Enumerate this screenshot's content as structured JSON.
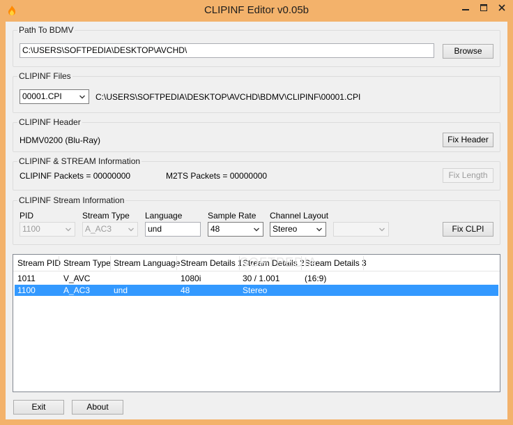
{
  "window": {
    "title": "CLIPINF Editor v0.05b",
    "icon": "flame-app-icon",
    "controls": {
      "minimize": "–",
      "maximize": "☐",
      "close": "✕"
    }
  },
  "path_group": {
    "title": "Path To BDMV",
    "path_value": "C:\\USERS\\SOFTPEDIA\\DESKTOP\\AVCHD\\",
    "browse_label": "Browse"
  },
  "files_group": {
    "title": "CLIPINF Files",
    "selected_file": "00001.CPI",
    "full_path": "C:\\USERS\\SOFTPEDIA\\DESKTOP\\AVCHD\\BDMV\\CLIPINF\\00001.CPI"
  },
  "header_group": {
    "title": "CLIPINF Header",
    "value": "HDMV0200 (Blu-Ray)",
    "fix_header_label": "Fix Header"
  },
  "stream_info_group": {
    "title": "CLIPINF & STREAM Information",
    "clipinf_packets": "CLIPINF Packets = 00000000",
    "m2ts_packets": "M2TS Packets = 00000000",
    "fix_length_label": "Fix Length"
  },
  "stream_group": {
    "title": "CLIPINF Stream Information",
    "labels": {
      "pid": "PID",
      "stream_type": "Stream Type",
      "language": "Language",
      "sample_rate": "Sample Rate",
      "channel_layout": "Channel Layout"
    },
    "values": {
      "pid": "1100",
      "stream_type": "A_AC3",
      "language": "und",
      "sample_rate": "48",
      "channel_layout": "Stereo",
      "extra": ""
    },
    "fix_clpi_label": "Fix CLPI"
  },
  "stream_list": {
    "columns": [
      "Stream PID",
      "Stream Type",
      "Stream Language",
      "Stream Details 1",
      "Stream Details 2",
      "Stream Details 3"
    ],
    "rows": [
      [
        "1011",
        "V_AVC",
        "",
        "1080i",
        "30 / 1.001",
        "(16:9)"
      ],
      [
        "1100",
        "A_AC3",
        "und",
        "48",
        "Stereo",
        ""
      ]
    ],
    "selected_row": 1,
    "watermark": "SOFTPEDIA"
  },
  "footer": {
    "exit_label": "Exit",
    "about_label": "About"
  },
  "colors": {
    "frame": "#f3b26b",
    "selection": "#3399ff",
    "client": "#f0f0f0"
  }
}
